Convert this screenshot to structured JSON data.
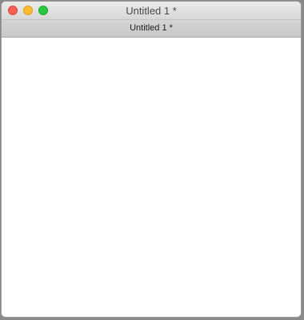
{
  "window": {
    "title": "Untitled 1 *"
  },
  "tabs": [
    {
      "label": "Untitled 1 *",
      "active": true
    }
  ],
  "colors": {
    "close": "#fc5f57",
    "minimize": "#fdbc2e",
    "maximize": "#29c840"
  }
}
